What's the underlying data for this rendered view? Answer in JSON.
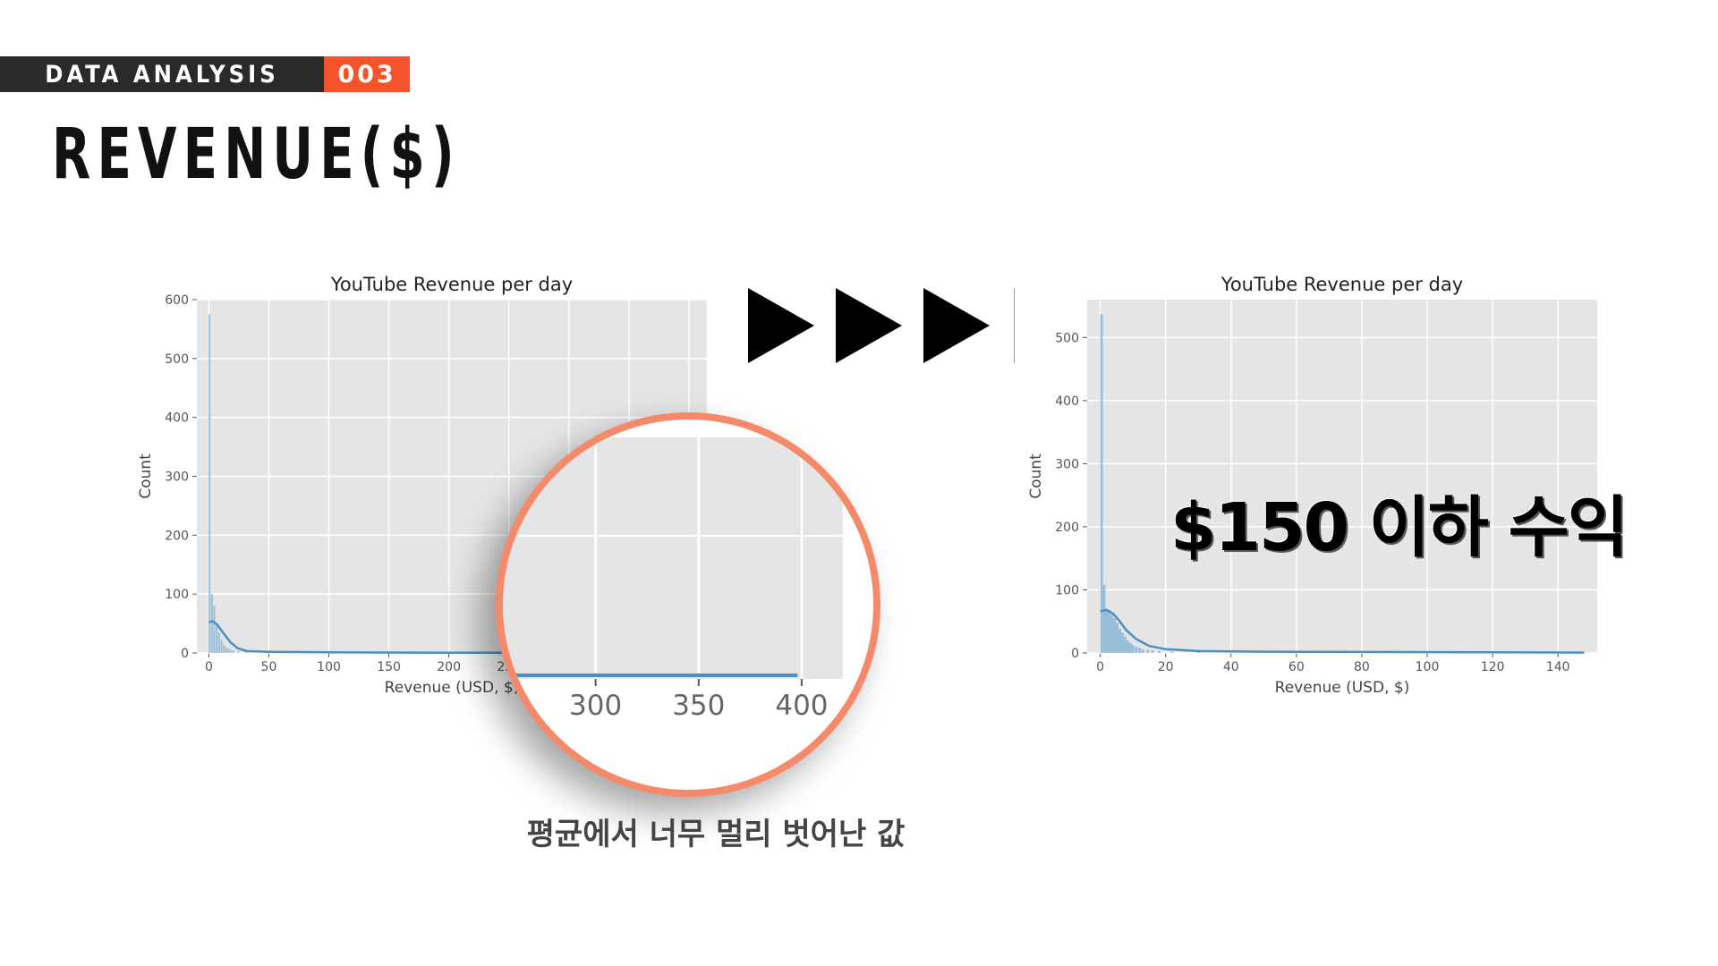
{
  "header": {
    "section": "DATA ANALYSIS",
    "number": "003",
    "title": "REVENUE($)"
  },
  "caption": "평균에서 너무 멀리 벗어난 값",
  "overlay": "$150 이하 수익",
  "colors": {
    "accent": "#f5532c",
    "zoom_ring": "#f58a6b",
    "bar": "#7fb0d6",
    "kde": "#4a90c2",
    "plot_bg": "#e5e5e5"
  },
  "chart_data": [
    {
      "type": "bar",
      "title": "YouTube Revenue per day",
      "xlabel": "Revenue (USD, $)",
      "ylabel": "Count",
      "xlim": [
        -10,
        415
      ],
      "ylim": [
        0,
        600
      ],
      "xticks": [
        0,
        50,
        100,
        150,
        200,
        250,
        300,
        350,
        400
      ],
      "yticks": [
        0,
        100,
        200,
        300,
        400,
        500,
        600
      ],
      "bins": [
        {
          "x": 0.5,
          "count": 575
        },
        {
          "x": 2.5,
          "count": 100
        },
        {
          "x": 4.5,
          "count": 80
        },
        {
          "x": 6.5,
          "count": 50
        },
        {
          "x": 8.5,
          "count": 35
        },
        {
          "x": 10.5,
          "count": 22
        },
        {
          "x": 12.5,
          "count": 14
        },
        {
          "x": 14.5,
          "count": 10
        },
        {
          "x": 16.5,
          "count": 7
        },
        {
          "x": 18.5,
          "count": 5
        },
        {
          "x": 20.5,
          "count": 4
        },
        {
          "x": 24.5,
          "count": 3
        },
        {
          "x": 30.5,
          "count": 2
        },
        {
          "x": 74.5,
          "count": 3
        },
        {
          "x": 140.5,
          "count": 1
        }
      ],
      "kde": [
        [
          0,
          52
        ],
        [
          3,
          54
        ],
        [
          7,
          48
        ],
        [
          12,
          34
        ],
        [
          18,
          18
        ],
        [
          24,
          8
        ],
        [
          32,
          3
        ],
        [
          50,
          2
        ],
        [
          100,
          1
        ],
        [
          200,
          0.5
        ],
        [
          300,
          0.5
        ],
        [
          400,
          0.3
        ]
      ],
      "grid": true,
      "zoom": {
        "xticks": [
          300,
          350,
          400
        ],
        "range": [
          255,
          420
        ]
      }
    },
    {
      "type": "bar",
      "title": "YouTube Revenue per day",
      "xlabel": "Revenue (USD, $)",
      "ylabel": "Count",
      "xlim": [
        -4,
        152
      ],
      "ylim": [
        0,
        560
      ],
      "xticks": [
        0,
        20,
        40,
        60,
        80,
        100,
        120,
        140
      ],
      "yticks": [
        0,
        100,
        200,
        300,
        400,
        500
      ],
      "bins": [
        {
          "x": 0.4,
          "count": 537
        },
        {
          "x": 1.2,
          "count": 108
        },
        {
          "x": 2.0,
          "count": 70
        },
        {
          "x": 2.8,
          "count": 68
        },
        {
          "x": 3.6,
          "count": 60
        },
        {
          "x": 4.4,
          "count": 55
        },
        {
          "x": 5.2,
          "count": 48
        },
        {
          "x": 6.0,
          "count": 38
        },
        {
          "x": 6.8,
          "count": 32
        },
        {
          "x": 7.6,
          "count": 26
        },
        {
          "x": 8.4,
          "count": 20
        },
        {
          "x": 9.2,
          "count": 16
        },
        {
          "x": 10.0,
          "count": 13
        },
        {
          "x": 11.0,
          "count": 10
        },
        {
          "x": 12.0,
          "count": 8
        },
        {
          "x": 13.0,
          "count": 6
        },
        {
          "x": 14.5,
          "count": 5
        },
        {
          "x": 16.0,
          "count": 4
        },
        {
          "x": 18.0,
          "count": 3
        },
        {
          "x": 22.0,
          "count": 2
        },
        {
          "x": 30.0,
          "count": 3
        },
        {
          "x": 40.0,
          "count": 2
        },
        {
          "x": 75.0,
          "count": 4
        },
        {
          "x": 101.0,
          "count": 2
        },
        {
          "x": 137.0,
          "count": 3
        }
      ],
      "kde": [
        [
          0,
          66
        ],
        [
          2,
          68
        ],
        [
          4,
          62
        ],
        [
          6,
          50
        ],
        [
          8,
          36
        ],
        [
          11,
          22
        ],
        [
          15,
          11
        ],
        [
          20,
          6
        ],
        [
          30,
          3
        ],
        [
          50,
          2
        ],
        [
          80,
          1.5
        ],
        [
          120,
          1
        ],
        [
          148,
          0.5
        ]
      ],
      "grid": true
    }
  ]
}
